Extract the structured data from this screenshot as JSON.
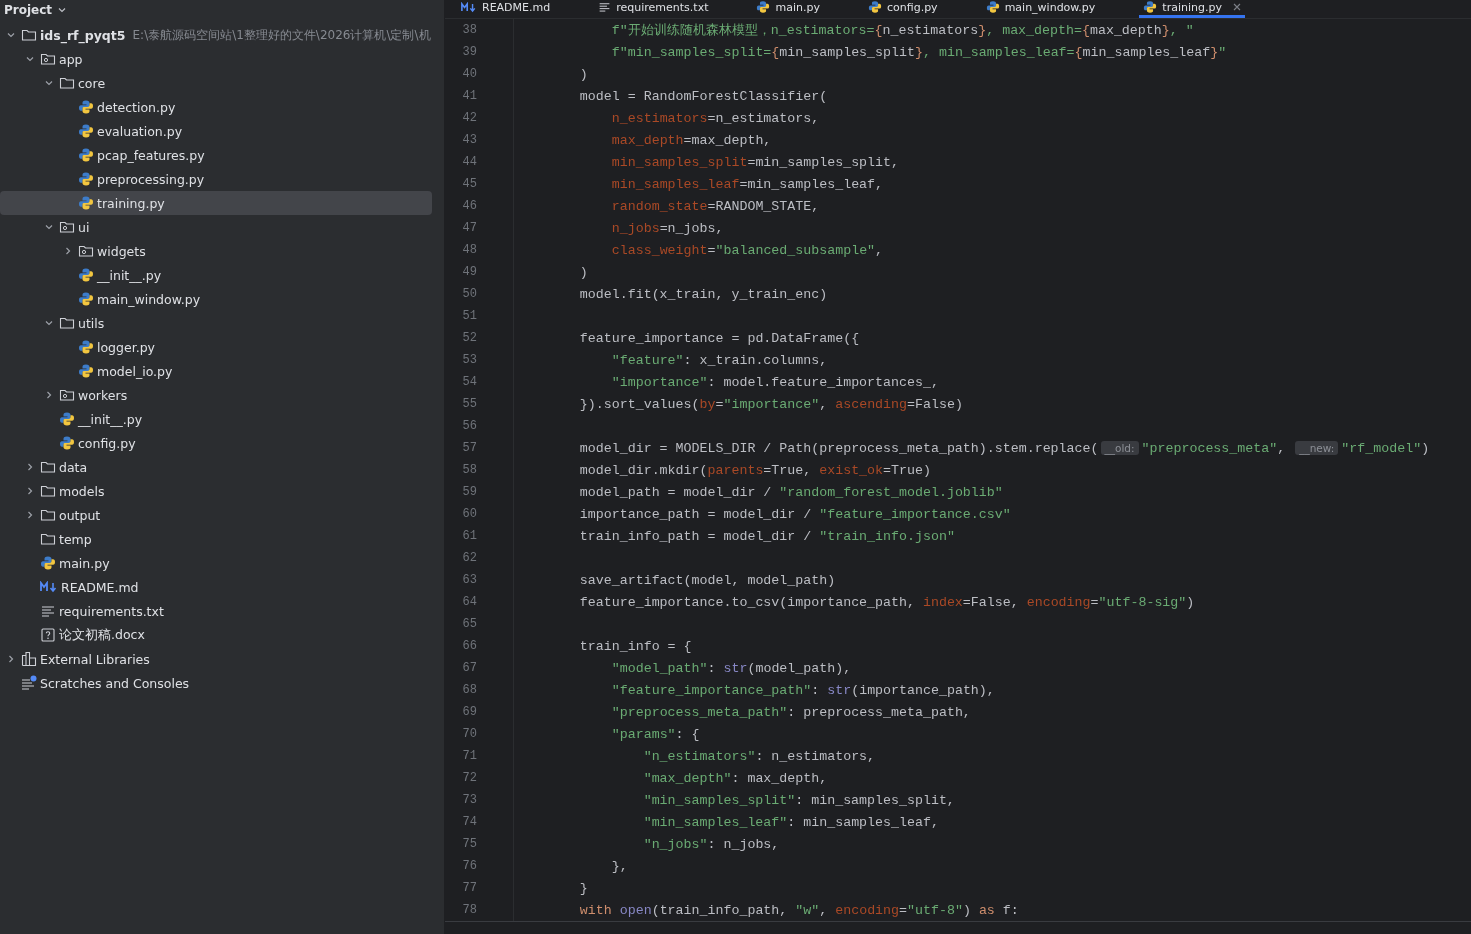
{
  "sidebar": {
    "title": "Project",
    "tree": [
      {
        "name": "ids_rf_pyqt5",
        "kind": "project",
        "path": "E:\\泰航源码空间站\\1整理好的文件\\2026计算机\\定制\\机",
        "expanded": true,
        "selected": false,
        "children": [
          {
            "name": "app",
            "kind": "package",
            "expanded": true,
            "selected": false,
            "children": [
              {
                "name": "core",
                "kind": "folder",
                "expanded": true,
                "selected": false,
                "children": [
                  {
                    "name": "detection.py",
                    "kind": "py",
                    "selected": false
                  },
                  {
                    "name": "evaluation.py",
                    "kind": "py",
                    "selected": false
                  },
                  {
                    "name": "pcap_features.py",
                    "kind": "py",
                    "selected": false
                  },
                  {
                    "name": "preprocessing.py",
                    "kind": "py",
                    "selected": false
                  },
                  {
                    "name": "training.py",
                    "kind": "py",
                    "selected": true
                  }
                ]
              },
              {
                "name": "ui",
                "kind": "package",
                "expanded": true,
                "selected": false,
                "children": [
                  {
                    "name": "widgets",
                    "kind": "package",
                    "expanded": false,
                    "selected": false
                  },
                  {
                    "name": "__init__.py",
                    "kind": "py",
                    "selected": false
                  },
                  {
                    "name": "main_window.py",
                    "kind": "py",
                    "selected": false
                  }
                ]
              },
              {
                "name": "utils",
                "kind": "folder",
                "expanded": true,
                "selected": false,
                "children": [
                  {
                    "name": "logger.py",
                    "kind": "py",
                    "selected": false
                  },
                  {
                    "name": "model_io.py",
                    "kind": "py",
                    "selected": false
                  }
                ]
              },
              {
                "name": "workers",
                "kind": "package",
                "expanded": false,
                "selected": false
              },
              {
                "name": "__init__.py",
                "kind": "py",
                "selected": false
              },
              {
                "name": "config.py",
                "kind": "py",
                "selected": false
              }
            ]
          },
          {
            "name": "data",
            "kind": "folder",
            "expanded": false,
            "selected": false
          },
          {
            "name": "models",
            "kind": "folder",
            "expanded": false,
            "selected": false
          },
          {
            "name": "output",
            "kind": "folder",
            "expanded": false,
            "selected": false
          },
          {
            "name": "temp",
            "kind": "folder",
            "selected": false
          },
          {
            "name": "main.py",
            "kind": "py",
            "selected": false
          },
          {
            "name": "README.md",
            "kind": "md",
            "selected": false
          },
          {
            "name": "requirements.txt",
            "kind": "txt",
            "selected": false
          },
          {
            "name": "论文初稿.docx",
            "kind": "unknown",
            "selected": false
          }
        ]
      },
      {
        "name": "External Libraries",
        "kind": "libs",
        "expanded": false,
        "selected": false
      },
      {
        "name": "Scratches and Consoles",
        "kind": "scratch",
        "selected": false
      }
    ]
  },
  "tabs": [
    {
      "label": "README.md",
      "kind": "md",
      "selected": false
    },
    {
      "label": "requirements.txt",
      "kind": "txt",
      "selected": false
    },
    {
      "label": "main.py",
      "kind": "py",
      "selected": false
    },
    {
      "label": "config.py",
      "kind": "py",
      "selected": false
    },
    {
      "label": "main_window.py",
      "kind": "py",
      "selected": false
    },
    {
      "label": "training.py",
      "kind": "py",
      "selected": true
    }
  ],
  "editor": {
    "lines": [
      {
        "num": "38",
        "tokens": [
          {
            "kind": "string",
            "text": "            f\"开始训练随机森林模型，n_estimators="
          },
          {
            "kind": "brace",
            "text": "{"
          },
          {
            "kind": "plain",
            "text": "n_estimators"
          },
          {
            "kind": "brace",
            "text": "}"
          },
          {
            "kind": "string",
            "text": ", max_depth="
          },
          {
            "kind": "brace",
            "text": "{"
          },
          {
            "kind": "plain",
            "text": "max_depth"
          },
          {
            "kind": "brace",
            "text": "}"
          },
          {
            "kind": "string",
            "text": ", \""
          }
        ]
      },
      {
        "num": "39",
        "tokens": [
          {
            "kind": "string",
            "text": "            f\"min_samples_split="
          },
          {
            "kind": "brace",
            "text": "{"
          },
          {
            "kind": "plain",
            "text": "min_samples_split"
          },
          {
            "kind": "brace",
            "text": "}"
          },
          {
            "kind": "string",
            "text": ", min_samples_leaf="
          },
          {
            "kind": "brace",
            "text": "{"
          },
          {
            "kind": "plain",
            "text": "min_samples_leaf"
          },
          {
            "kind": "brace",
            "text": "}"
          },
          {
            "kind": "string",
            "text": "\""
          }
        ]
      },
      {
        "num": "40",
        "tokens": [
          {
            "kind": "plain",
            "text": "        )"
          }
        ]
      },
      {
        "num": "41",
        "tokens": [
          {
            "kind": "plain",
            "text": "        model = RandomForestClassifier("
          }
        ]
      },
      {
        "num": "42",
        "tokens": [
          {
            "kind": "param",
            "text": "            n_estimators"
          },
          {
            "kind": "plain",
            "text": "=n_estimators,"
          }
        ]
      },
      {
        "num": "43",
        "tokens": [
          {
            "kind": "param",
            "text": "            max_depth"
          },
          {
            "kind": "plain",
            "text": "=max_depth,"
          }
        ]
      },
      {
        "num": "44",
        "tokens": [
          {
            "kind": "param",
            "text": "            min_samples_split"
          },
          {
            "kind": "plain",
            "text": "=min_samples_split,"
          }
        ]
      },
      {
        "num": "45",
        "tokens": [
          {
            "kind": "param",
            "text": "            min_samples_leaf"
          },
          {
            "kind": "plain",
            "text": "=min_samples_leaf,"
          }
        ]
      },
      {
        "num": "46",
        "tokens": [
          {
            "kind": "param",
            "text": "            random_state"
          },
          {
            "kind": "plain",
            "text": "=RANDOM_STATE,"
          }
        ]
      },
      {
        "num": "47",
        "tokens": [
          {
            "kind": "param",
            "text": "            n_jobs"
          },
          {
            "kind": "plain",
            "text": "=n_jobs,"
          }
        ]
      },
      {
        "num": "48",
        "tokens": [
          {
            "kind": "param",
            "text": "            class_weight"
          },
          {
            "kind": "plain",
            "text": "="
          },
          {
            "kind": "string",
            "text": "\"balanced_subsample\""
          },
          {
            "kind": "plain",
            "text": ","
          }
        ]
      },
      {
        "num": "49",
        "tokens": [
          {
            "kind": "plain",
            "text": "        )"
          }
        ]
      },
      {
        "num": "50",
        "tokens": [
          {
            "kind": "plain",
            "text": "        model.fit(x_train, y_train_enc)"
          }
        ]
      },
      {
        "num": "51"
      },
      {
        "num": "52",
        "tokens": [
          {
            "kind": "plain",
            "text": "        feature_importance = pd.DataFrame({"
          }
        ]
      },
      {
        "num": "53",
        "tokens": [
          {
            "kind": "string",
            "text": "            \"feature\""
          },
          {
            "kind": "plain",
            "text": ": x_train.columns,"
          }
        ]
      },
      {
        "num": "54",
        "tokens": [
          {
            "kind": "string",
            "text": "            \"importance\""
          },
          {
            "kind": "plain",
            "text": ": model.feature_importances_,"
          }
        ]
      },
      {
        "num": "55",
        "tokens": [
          {
            "kind": "plain",
            "text": "        }).sort_values("
          },
          {
            "kind": "param",
            "text": "by"
          },
          {
            "kind": "plain",
            "text": "="
          },
          {
            "kind": "string",
            "text": "\"importance\""
          },
          {
            "kind": "plain",
            "text": ", "
          },
          {
            "kind": "param",
            "text": "ascending"
          },
          {
            "kind": "plain",
            "text": "=False)"
          }
        ]
      },
      {
        "num": "56"
      },
      {
        "num": "57",
        "tokens": [
          {
            "kind": "plain",
            "text": "        model_dir = MODELS_DIR / Path(preprocess_meta_path).stem.replace("
          },
          {
            "kind": "hint",
            "text": "__old:"
          },
          {
            "kind": "string",
            "text": "\"preprocess_meta\""
          },
          {
            "kind": "plain",
            "text": ", "
          },
          {
            "kind": "hint",
            "text": "__new:"
          },
          {
            "kind": "string",
            "text": "\"rf_model\""
          },
          {
            "kind": "plain",
            "text": ")"
          }
        ]
      },
      {
        "num": "58",
        "tokens": [
          {
            "kind": "plain",
            "text": "        model_dir.mkdir("
          },
          {
            "kind": "param",
            "text": "parents"
          },
          {
            "kind": "plain",
            "text": "=True, "
          },
          {
            "kind": "param",
            "text": "exist_ok"
          },
          {
            "kind": "plain",
            "text": "=True)"
          }
        ]
      },
      {
        "num": "59",
        "tokens": [
          {
            "kind": "plain",
            "text": "        model_path = model_dir / "
          },
          {
            "kind": "string",
            "text": "\"random_forest_model.joblib\""
          }
        ]
      },
      {
        "num": "60",
        "tokens": [
          {
            "kind": "plain",
            "text": "        importance_path = model_dir / "
          },
          {
            "kind": "string",
            "text": "\"feature_importance.csv\""
          }
        ]
      },
      {
        "num": "61",
        "tokens": [
          {
            "kind": "plain",
            "text": "        train_info_path = model_dir / "
          },
          {
            "kind": "string",
            "text": "\"train_info.json\""
          }
        ]
      },
      {
        "num": "62"
      },
      {
        "num": "63",
        "tokens": [
          {
            "kind": "plain",
            "text": "        save_artifact(model, model_path)"
          }
        ]
      },
      {
        "num": "64",
        "tokens": [
          {
            "kind": "plain",
            "text": "        feature_importance.to_csv(importance_path, "
          },
          {
            "kind": "param",
            "text": "index"
          },
          {
            "kind": "plain",
            "text": "=False, "
          },
          {
            "kind": "param",
            "text": "encoding"
          },
          {
            "kind": "plain",
            "text": "="
          },
          {
            "kind": "string",
            "text": "\"utf-8-sig\""
          },
          {
            "kind": "plain",
            "text": ")"
          }
        ]
      },
      {
        "num": "65"
      },
      {
        "num": "66",
        "tokens": [
          {
            "kind": "plain",
            "text": "        train_info = {"
          }
        ]
      },
      {
        "num": "67",
        "tokens": [
          {
            "kind": "string",
            "text": "            \"model_path\""
          },
          {
            "kind": "plain",
            "text": ": "
          },
          {
            "kind": "builtin",
            "text": "str"
          },
          {
            "kind": "plain",
            "text": "(model_path),"
          }
        ]
      },
      {
        "num": "68",
        "tokens": [
          {
            "kind": "string",
            "text": "            \"feature_importance_path\""
          },
          {
            "kind": "plain",
            "text": ": "
          },
          {
            "kind": "builtin",
            "text": "str"
          },
          {
            "kind": "plain",
            "text": "(importance_path),"
          }
        ]
      },
      {
        "num": "69",
        "tokens": [
          {
            "kind": "string",
            "text": "            \"preprocess_meta_path\""
          },
          {
            "kind": "plain",
            "text": ": preprocess_meta_path,"
          }
        ]
      },
      {
        "num": "70",
        "tokens": [
          {
            "kind": "string",
            "text": "            \"params\""
          },
          {
            "kind": "plain",
            "text": ": {"
          }
        ]
      },
      {
        "num": "71",
        "tokens": [
          {
            "kind": "string",
            "text": "                \"n_estimators\""
          },
          {
            "kind": "plain",
            "text": ": n_estimators,"
          }
        ]
      },
      {
        "num": "72",
        "tokens": [
          {
            "kind": "string",
            "text": "                \"max_depth\""
          },
          {
            "kind": "plain",
            "text": ": max_depth,"
          }
        ]
      },
      {
        "num": "73",
        "tokens": [
          {
            "kind": "string",
            "text": "                \"min_samples_split\""
          },
          {
            "kind": "plain",
            "text": ": min_samples_split,"
          }
        ]
      },
      {
        "num": "74",
        "tokens": [
          {
            "kind": "string",
            "text": "                \"min_samples_leaf\""
          },
          {
            "kind": "plain",
            "text": ": min_samples_leaf,"
          }
        ]
      },
      {
        "num": "75",
        "tokens": [
          {
            "kind": "string",
            "text": "                \"n_jobs\""
          },
          {
            "kind": "plain",
            "text": ": n_jobs,"
          }
        ]
      },
      {
        "num": "76",
        "tokens": [
          {
            "kind": "plain",
            "text": "            },"
          }
        ]
      },
      {
        "num": "77",
        "tokens": [
          {
            "kind": "plain",
            "text": "        }"
          }
        ]
      },
      {
        "num": "78",
        "tokens": [
          {
            "kind": "keyword",
            "text": "        with "
          },
          {
            "kind": "builtin",
            "text": "open"
          },
          {
            "kind": "plain",
            "text": "(train_info_path, "
          },
          {
            "kind": "string",
            "text": "\"w\""
          },
          {
            "kind": "plain",
            "text": ", "
          },
          {
            "kind": "param",
            "text": "encoding"
          },
          {
            "kind": "plain",
            "text": "="
          },
          {
            "kind": "string",
            "text": "\"utf-8\""
          },
          {
            "kind": "plain",
            "text": ") "
          },
          {
            "kind": "keyword",
            "text": "as"
          },
          {
            "kind": "plain",
            "text": " f:"
          }
        ]
      }
    ]
  }
}
